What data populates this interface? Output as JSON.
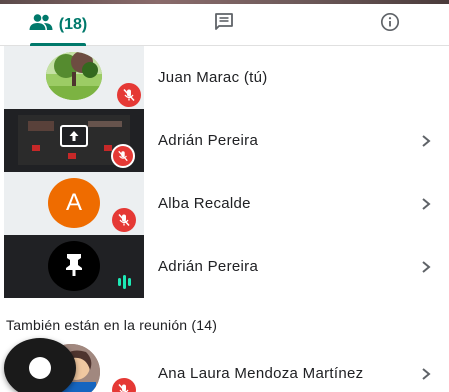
{
  "tabs": {
    "people_count": "(18)",
    "people_icon": "people-icon",
    "chat_icon": "chat-icon",
    "info_icon": "info-icon",
    "accent": "#00796b"
  },
  "participants": [
    {
      "name": "Juan Marac (tú)",
      "tile": "photo-avatar",
      "muted": true,
      "chevron": false
    },
    {
      "name": "Adrián Pereira",
      "tile": "screen-share",
      "muted": true,
      "chevron": true
    },
    {
      "name": "Alba Recalde",
      "tile": "letter-avatar",
      "avatar_letter": "A",
      "avatar_color": "#ef6c00",
      "muted": true,
      "chevron": true
    },
    {
      "name": "Adrián Pereira",
      "tile": "pin-avatar",
      "speaking": true,
      "chevron": true
    }
  ],
  "other_section": {
    "title": "También están en la reunión (14)",
    "items": [
      {
        "name": "Ana Laura Mendoza Martínez",
        "muted": true,
        "chevron": true
      }
    ]
  },
  "colors": {
    "mute_badge": "#e53935",
    "speaking": "#1de9b6"
  }
}
